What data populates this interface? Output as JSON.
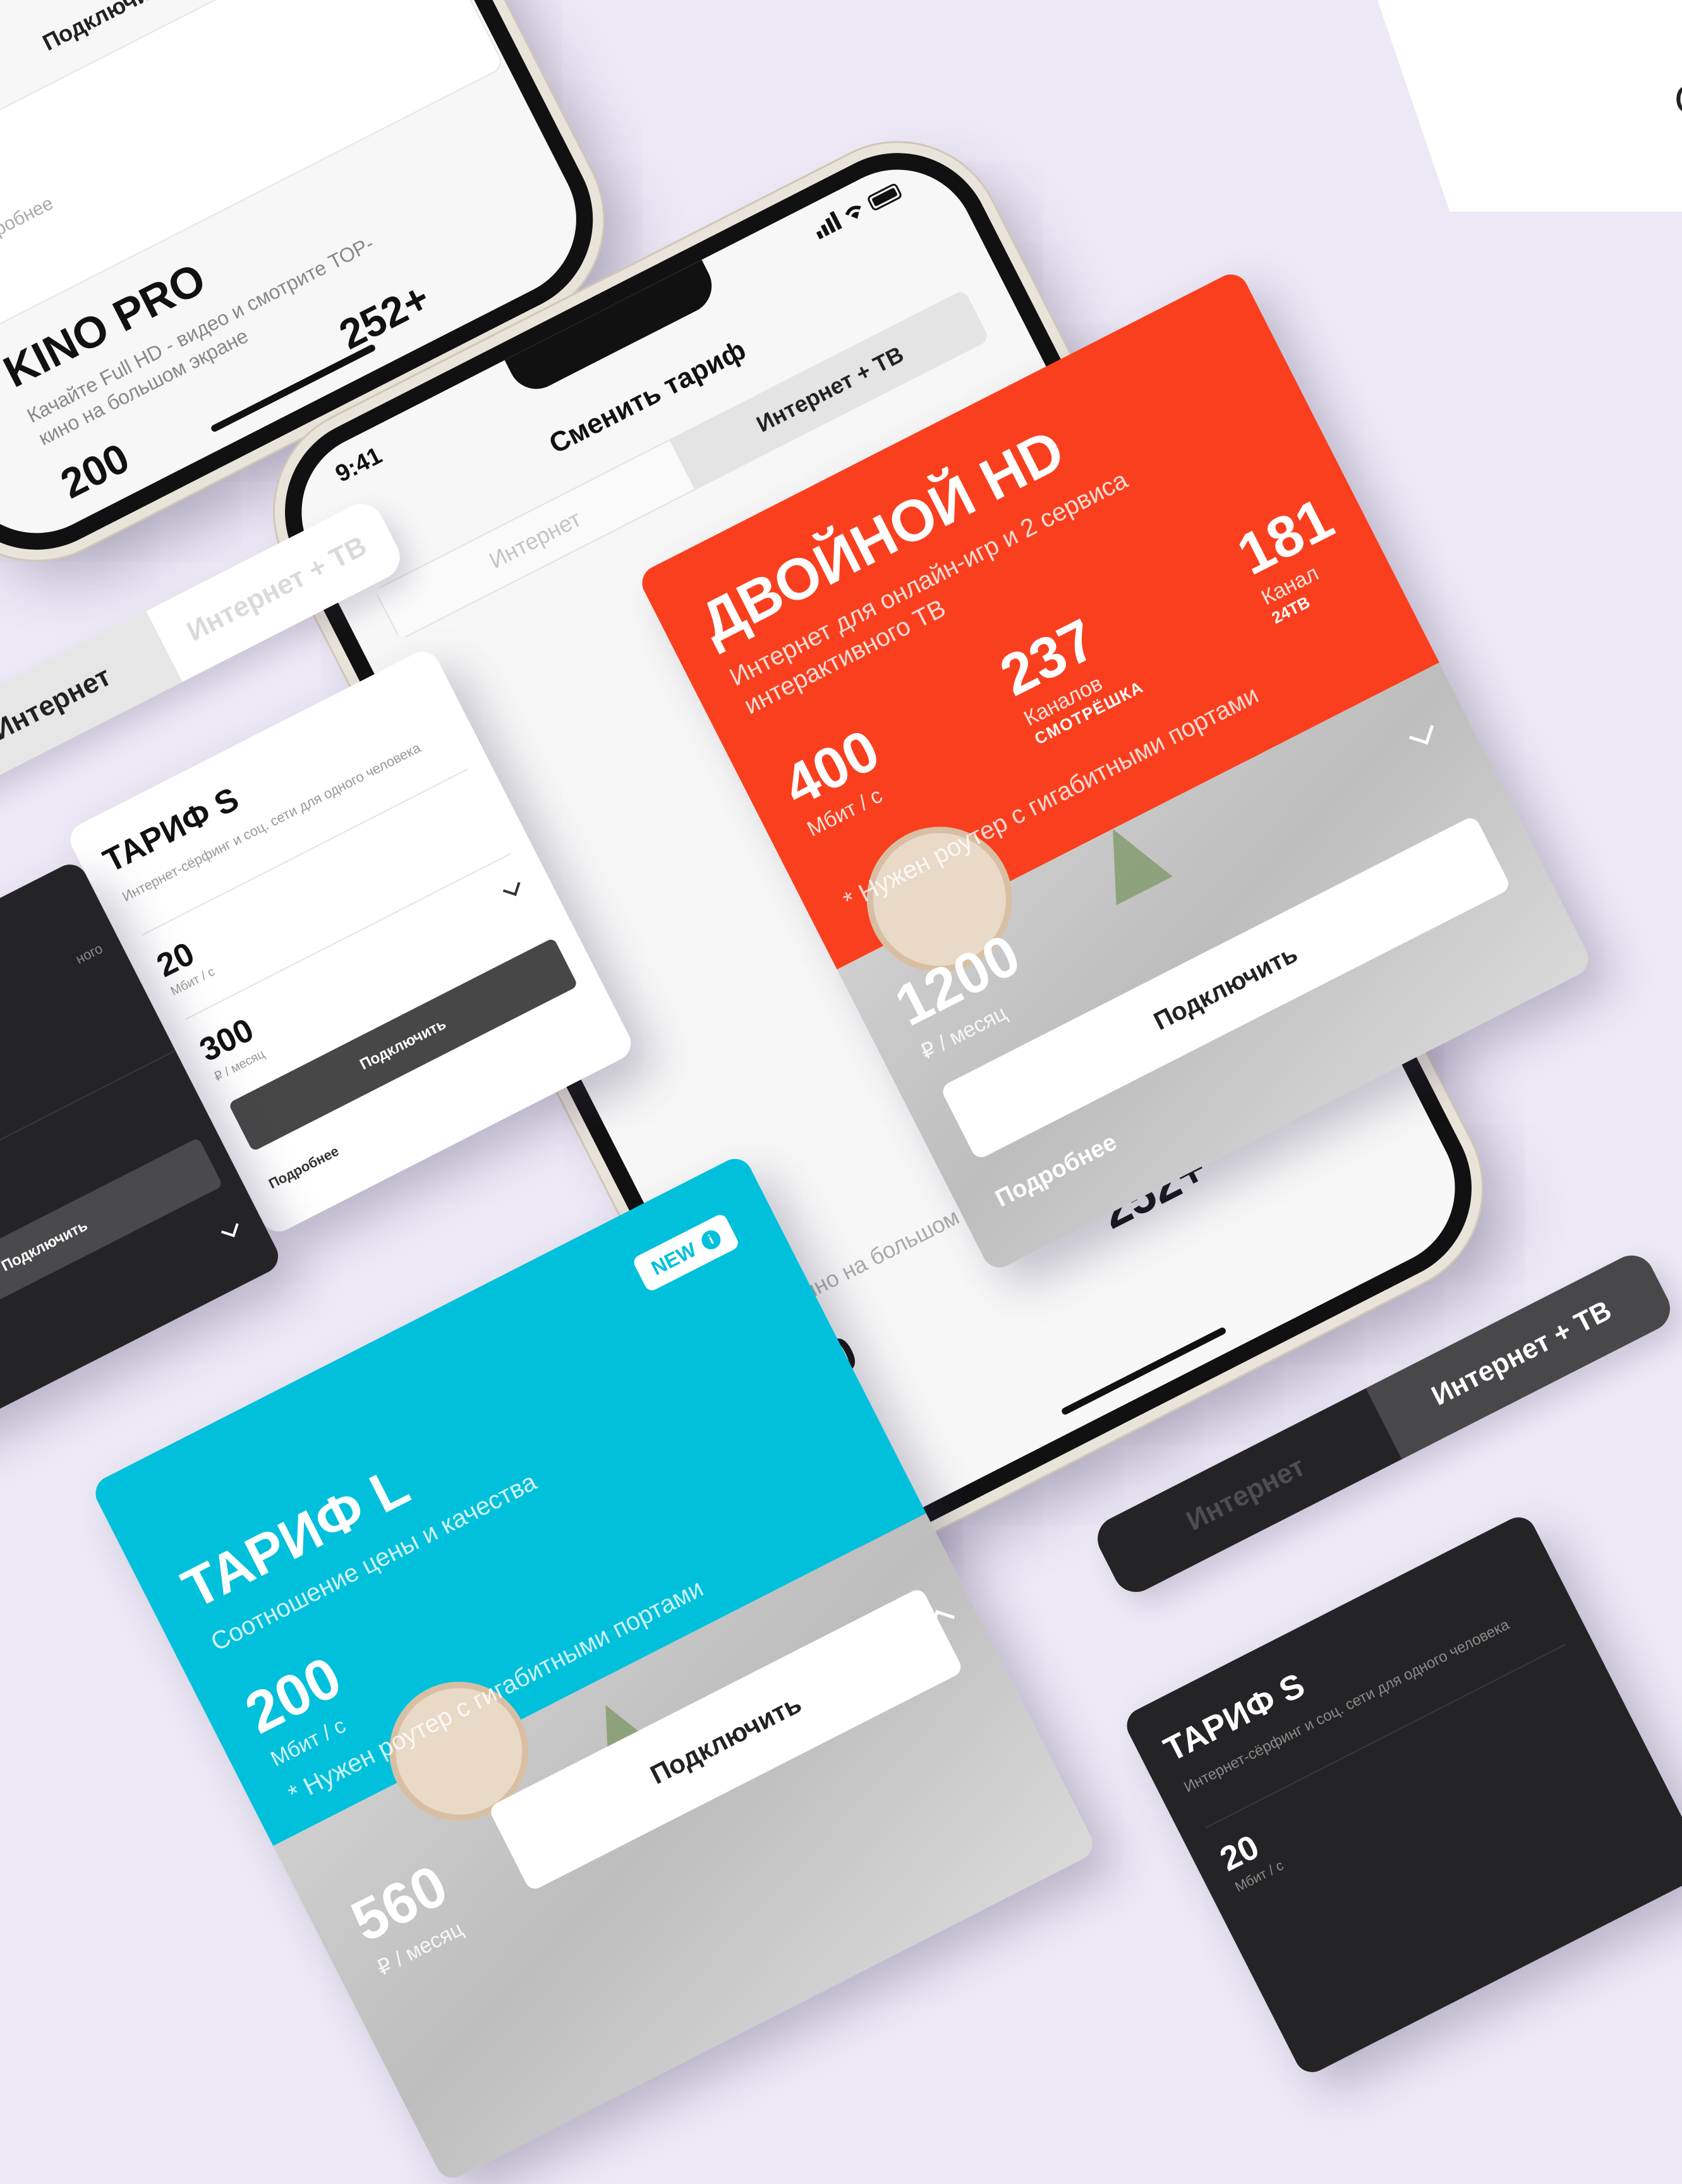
{
  "corner": {
    "letter": "О"
  },
  "phone_main": {
    "time": "9:41",
    "status_icons": [
      "signal-icon",
      "wifi-icon",
      "battery-icon"
    ],
    "back_icon": "chevron-left-icon",
    "title": "Сменить тариф",
    "tabs": [
      "Интернет",
      "Интернет + ТВ"
    ],
    "below_card_desc": "ТОР-кино на большом экране",
    "below_card_price": "200",
    "below_card_channels": "252+"
  },
  "card_hd": {
    "title": "ДВОЙНОЙ HD",
    "subtitle": "Интернет для онлайн-игр и 2 сервиса интерактивного ТВ",
    "stats": [
      {
        "value": "400",
        "label": "Мбит / с",
        "logo": ""
      },
      {
        "value": "237",
        "label": "Каналов",
        "logo": "СМОТРЁШКА"
      },
      {
        "value": "181",
        "label": "Канал",
        "logo": "24ТВ"
      }
    ],
    "note": "* Нужен роутер с гигабитными портами",
    "price": "1200",
    "price_unit": "₽ / месяц",
    "connect": "Подключить",
    "more": "Подробнее",
    "color": "#fa3f1e"
  },
  "phone_topleft": {
    "connect": "Подключить",
    "more": "Подробнее",
    "title": "KINO PRO",
    "desc": "Качайте Full HD - видео и смотрите ТОР-кино на большом экране",
    "price": "200",
    "channels": "252+"
  },
  "seg_light": {
    "tabs": [
      "Интернет",
      "Интернет + ТВ"
    ]
  },
  "card_s_light": {
    "title": "ТАРИФ S",
    "desc": "Интернет-сёрфинг и соц. сети для одного человека",
    "speed": "20",
    "speed_unit": "Мбит / с",
    "price": "300",
    "price_unit": "₽ / месяц",
    "connect": "Подключить",
    "more": "Подробнее"
  },
  "card_dark_left": {
    "desc_tail": "ного",
    "connect": "Подключить"
  },
  "card_l": {
    "badge": "NEW",
    "title": "ТАРИФ L",
    "subtitle": "Соотношение цены и качества",
    "speed": "200",
    "speed_unit": "Мбит / с",
    "note": "* Нужен роутер с гигабитными портами",
    "price": "560",
    "price_unit": "₽ / месяц",
    "connect": "Подключить",
    "color": "#00c0dc"
  },
  "seg_dark": {
    "tabs": [
      "Интернет",
      "Интернет + ТВ"
    ]
  },
  "card_s_dark": {
    "title": "ТАРИФ S",
    "desc": "Интернет-сёрфинг и соц. сети для одного человека",
    "speed": "20",
    "speed_unit": "Мбит / с"
  }
}
